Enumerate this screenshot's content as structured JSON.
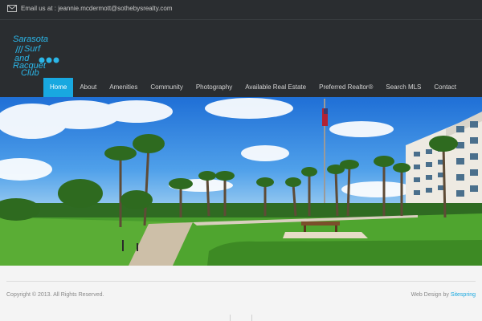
{
  "topbar": {
    "email_text": "Email us at : jeannie.mcdermott@sothebysrealty.com",
    "icon": "envelope-icon"
  },
  "logo": {
    "line1": "Sarasota",
    "line2": "Surf",
    "line3": "and",
    "line4": "Racquet",
    "line5": "Club",
    "color": "#2bb6e8"
  },
  "nav": {
    "items": [
      {
        "label": "Home"
      },
      {
        "label": "About"
      },
      {
        "label": "Amenities"
      },
      {
        "label": "Community"
      },
      {
        "label": "Photography"
      },
      {
        "label": "Available Real Estate"
      },
      {
        "label": "Preferred Realtor®"
      },
      {
        "label": "Search MLS"
      },
      {
        "label": "Contact"
      }
    ],
    "active_color": "#18a8e0"
  },
  "footer": {
    "copyright": "Copyright © 2013. All Rights Reserved.",
    "credit_prefix": "Web Design by ",
    "credit_link": "Sitespring"
  },
  "colors": {
    "header_bg": "#2a2d30",
    "accent": "#18a8e0"
  }
}
